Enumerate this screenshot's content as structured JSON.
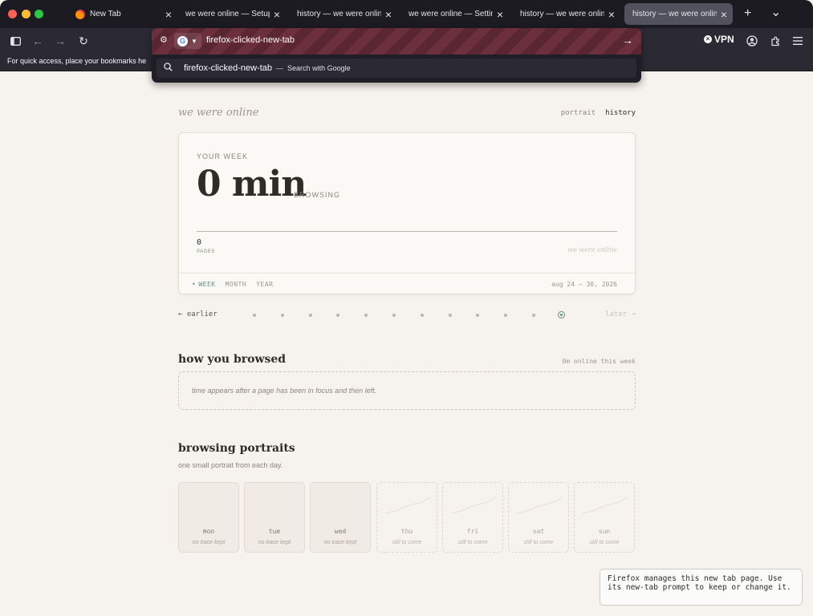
{
  "browser": {
    "tabs": [
      {
        "label": "New Tab",
        "active": false
      },
      {
        "label": "we were online — Setup",
        "active": false
      },
      {
        "label": "history — we were online",
        "active": false
      },
      {
        "label": "we were online — Settings",
        "active": false
      },
      {
        "label": "history — we were online",
        "active": false
      },
      {
        "label": "history — we were online",
        "active": true
      }
    ],
    "new_tab_glyph": "+",
    "tab_list_glyph": "⌄",
    "bookmarks_hint": "For quick access, place your bookmarks he",
    "vpn_label": "VPN",
    "url_value": "firefox-clicked-new-tab",
    "suggestion": {
      "text": "firefox-clicked-new-tab",
      "separator": "—",
      "hint": "Search with Google"
    }
  },
  "page": {
    "brand": "we were online",
    "nav": {
      "portrait": "portrait",
      "history": "history"
    },
    "summary": {
      "eyebrow": "YOUR WEEK",
      "value": "0 min",
      "unit": "BROWSING",
      "pages_count": "0",
      "pages_label": "PAGES",
      "watermark": "we were online",
      "ranges": [
        "WEEK",
        "MONTH",
        "YEAR"
      ],
      "active_range": "WEEK",
      "date_range": "aug 24 – 30, 2026"
    },
    "pager": {
      "earlier": "← earlier",
      "later": "later →",
      "dot_count": 12,
      "current_index": 11
    },
    "how_you_browsed": {
      "title": "how you browsed",
      "aside": "0m online this week",
      "empty": "time appears after a page has been in focus and then left."
    },
    "portraits": {
      "title": "browsing portraits",
      "subtitle": "one small portrait from each day.",
      "days": [
        {
          "name": "mon",
          "note": "no trace kept",
          "state": "past"
        },
        {
          "name": "tue",
          "note": "no trace kept",
          "state": "past"
        },
        {
          "name": "wed",
          "note": "no trace kept",
          "state": "past"
        },
        {
          "name": "thu",
          "note": "still to come",
          "state": "future"
        },
        {
          "name": "fri",
          "note": "still to come",
          "state": "future"
        },
        {
          "name": "sat",
          "note": "still to come",
          "state": "future"
        },
        {
          "name": "sun",
          "note": "still to come",
          "state": "future"
        }
      ]
    },
    "toast": "Firefox manages this new tab page. Use its new-tab prompt to keep or change it."
  },
  "colors": {
    "accent": "#5f8f7a",
    "page_bg": "#f6f3ee",
    "chrome_dark": "#2b2a33",
    "url_stripe": "#6b2f3d"
  }
}
